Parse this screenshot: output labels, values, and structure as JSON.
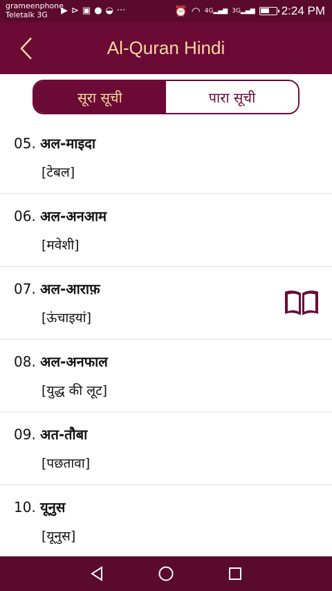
{
  "status": {
    "carrier_1": "grameenphone",
    "carrier_2": "Teletalk 3G",
    "signal_1": "4G",
    "signal_2": "3G",
    "time": "2:24 PM"
  },
  "header": {
    "title": "Al-Quran Hindi"
  },
  "tabs": [
    {
      "label": "सूरा सूची",
      "active": true
    },
    {
      "label": "पारा सूची",
      "active": false
    }
  ],
  "surahs": [
    {
      "number": "05.",
      "name": "अल-माइदा",
      "meaning": "[टेबल]"
    },
    {
      "number": "06.",
      "name": "अल-अनआम",
      "meaning": "[मवेशी]"
    },
    {
      "number": "07.",
      "name": "अल-आराफ़",
      "meaning": "[ऊंचाइयां]"
    },
    {
      "number": "08.",
      "name": "अल-अनफाल",
      "meaning": "[युद्ध की लूट]"
    },
    {
      "number": "09.",
      "name": "अत-तौबा",
      "meaning": "[पछतावा]"
    },
    {
      "number": "10.",
      "name": "यूनुस",
      "meaning": "[यूनुस]"
    }
  ],
  "colors": {
    "primary": "#6b0a35",
    "status_bar": "#5a0a2c",
    "accent_text": "#f7d9a0"
  }
}
